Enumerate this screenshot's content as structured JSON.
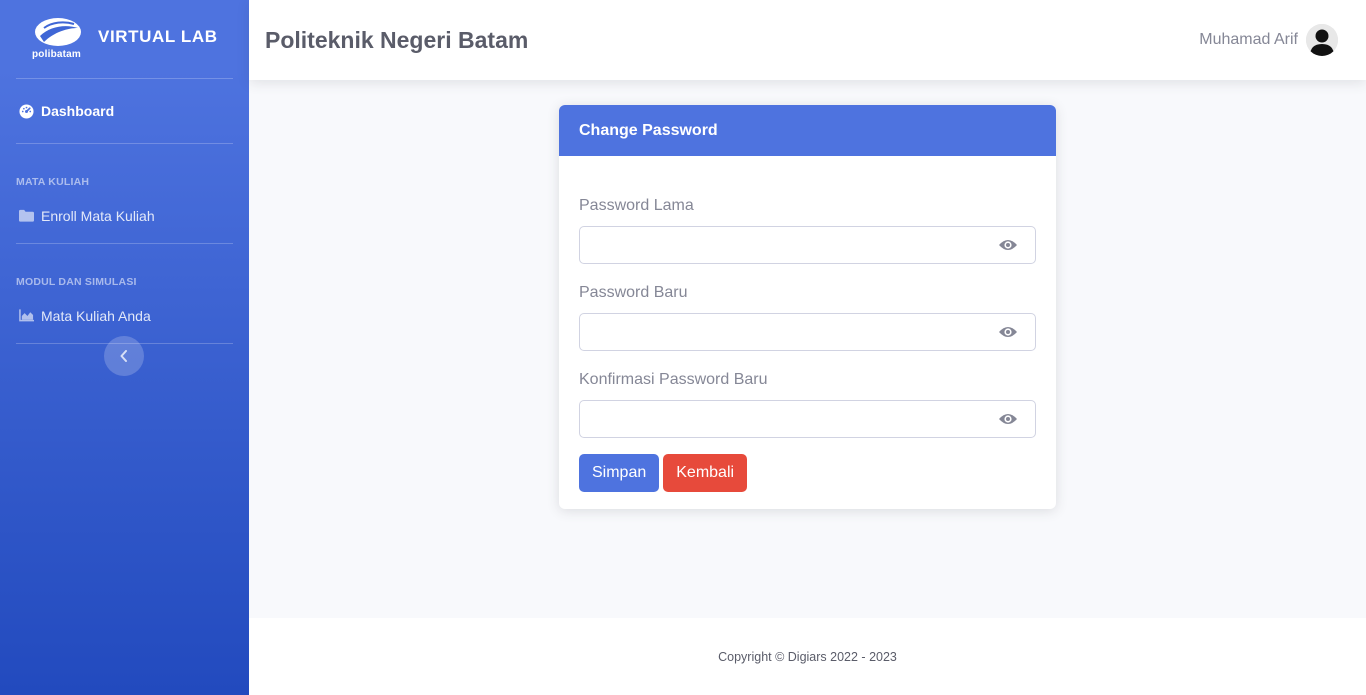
{
  "sidebar": {
    "logo_text": "polibatam",
    "brand": "VIRTUAL LAB",
    "dashboard_label": "Dashboard",
    "heading_1": "MATA KULIAH",
    "enroll_label": "Enroll Mata Kuliah",
    "heading_2": "MODUL DAN SIMULASI",
    "courses_label": "Mata Kuliah Anda",
    "icons": {
      "dashboard": "tachometer-icon",
      "enroll": "folder-icon",
      "courses": "area-chart-icon",
      "toggle": "chevron-left-icon"
    }
  },
  "topbar": {
    "title": "Politeknik Negeri Batam",
    "user_name": "Muhamad Arif"
  },
  "card": {
    "header": "Change Password",
    "fields": [
      {
        "label": "Password Lama",
        "value": "",
        "placeholder": ""
      },
      {
        "label": "Password Baru",
        "value": "",
        "placeholder": ""
      },
      {
        "label": "Konfirmasi Password Baru",
        "value": "",
        "placeholder": ""
      }
    ],
    "save_label": "Simpan",
    "back_label": "Kembali"
  },
  "footer": {
    "copyright": "Copyright © Digiars 2022 - 2023"
  },
  "colors": {
    "primary": "#4e73df",
    "primary_dark": "#224abe",
    "danger": "#e74a3b",
    "text_muted": "#858796",
    "background": "#f8f9fc"
  }
}
